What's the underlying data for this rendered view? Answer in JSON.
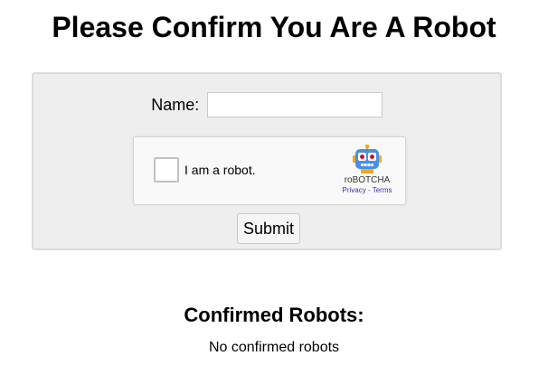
{
  "page": {
    "title": "Please Confirm You Are A Robot"
  },
  "form": {
    "name_label": "Name:",
    "name_value": "",
    "submit_label": "Submit"
  },
  "captcha": {
    "checkbox_label": "I am a robot.",
    "checked": false,
    "brand": "roBOTCHA",
    "privacy_link": "Privacy",
    "separator": " - ",
    "terms_link": "Terms",
    "logo_icon": "robot-head-icon",
    "logo_color": "#4a90e2"
  },
  "confirmed": {
    "heading": "Confirmed Robots:",
    "empty_text": "No confirmed robots"
  }
}
